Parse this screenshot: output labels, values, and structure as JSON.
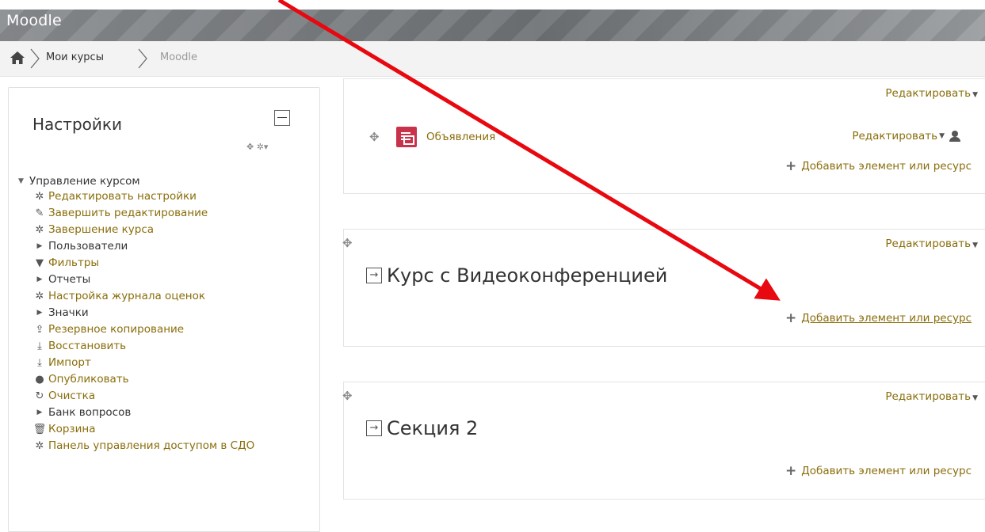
{
  "header": {
    "brand": "Moodle"
  },
  "breadcrumb": {
    "items": [
      "Мои курсы",
      "Moodle"
    ]
  },
  "settings": {
    "title": "Настройки",
    "actions_glyph": "✥ ✲▾",
    "group_label": "Управление курсом",
    "items": [
      {
        "label": "Редактировать настройки",
        "icon": "gear-icon",
        "link": true
      },
      {
        "label": "Завершить редактирование",
        "icon": "pencil-icon",
        "link": true
      },
      {
        "label": "Завершение курса",
        "icon": "gear-icon",
        "link": true
      },
      {
        "label": "Пользователи",
        "icon": "triangle-right-icon",
        "link": false
      },
      {
        "label": "Фильтры",
        "icon": "filter-icon",
        "link": true
      },
      {
        "label": "Отчеты",
        "icon": "triangle-right-icon",
        "link": false
      },
      {
        "label": "Настройка журнала оценок",
        "icon": "gear-icon",
        "link": true
      },
      {
        "label": "Значки",
        "icon": "triangle-right-icon",
        "link": false
      },
      {
        "label": "Резервное копирование",
        "icon": "upload-icon",
        "link": true
      },
      {
        "label": "Восстановить",
        "icon": "download-icon",
        "link": true
      },
      {
        "label": "Импорт",
        "icon": "download-icon",
        "link": true
      },
      {
        "label": "Опубликовать",
        "icon": "globe-icon",
        "link": true
      },
      {
        "label": "Очистка",
        "icon": "refresh-icon",
        "link": true
      },
      {
        "label": "Банк вопросов",
        "icon": "triangle-right-icon",
        "link": false
      },
      {
        "label": "Корзина",
        "icon": "trash-icon",
        "link": true
      },
      {
        "label": "Панель управления доступом в СДО",
        "icon": "gear-icon",
        "link": true
      }
    ]
  },
  "sections": {
    "edit_label": "Редактировать",
    "add_label": "Добавить элемент или ресурс",
    "activity_name": "Объявления",
    "section1_title": "Курс с Видеоконференцией",
    "section2_title": "Секция 2"
  },
  "colors": {
    "link": "#8a6d0b",
    "annotation": "#e8080f",
    "forum_icon": "#c8324a"
  }
}
